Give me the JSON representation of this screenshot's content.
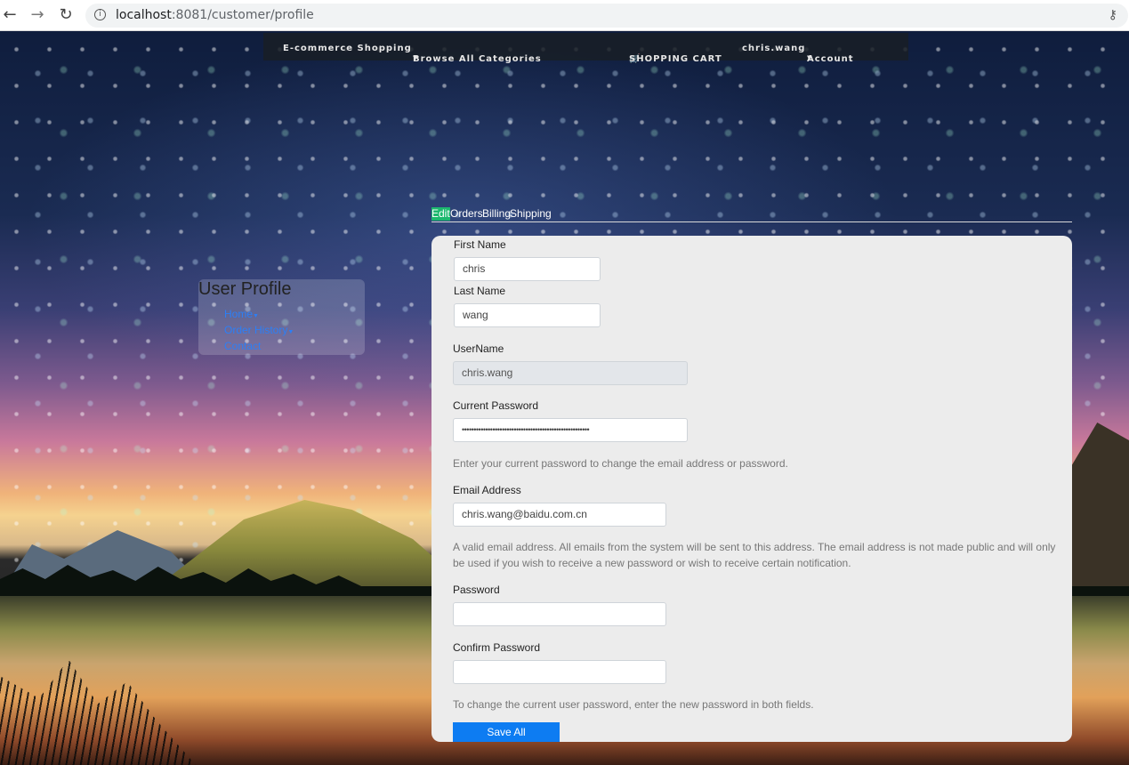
{
  "browser": {
    "url_host": "localhost",
    "url_port_path": ":8081/customer/profile"
  },
  "topnav": {
    "brand": "E-commerce Shopping",
    "categories": "Browse All Categories",
    "cart": "SHOPPING CART",
    "username": "chris.wang",
    "account": "Account"
  },
  "sidebar": {
    "title": "User Profile",
    "links": [
      "Home",
      "Order History",
      "Contact"
    ]
  },
  "tabs": [
    "Edit",
    "Orders",
    "Billing",
    "Shipping"
  ],
  "form": {
    "first_name_label": "First Name",
    "first_name_value": "chris",
    "last_name_label": "Last Name",
    "last_name_value": "wang",
    "username_label": "UserName",
    "username_value": "chris.wang",
    "current_password_label": "Current Password",
    "current_password_value": "••••••••••••••••••••••••••••••••••••••••••••••••••••••",
    "current_password_help": "Enter your current password to change the email address or password.",
    "email_label": "Email Address",
    "email_value": "chris.wang@baidu.com.cn",
    "email_help": "A valid email address. All emails from the system will be sent to this address. The email address is not made public and will only be used if you wish to receive a new password or wish to receive certain notification.",
    "password_label": "Password",
    "password_value": "",
    "confirm_password_label": "Confirm Password",
    "confirm_password_value": "",
    "password_help": "To change the current user password, enter the new password in both fields.",
    "save_label": "Save All"
  }
}
